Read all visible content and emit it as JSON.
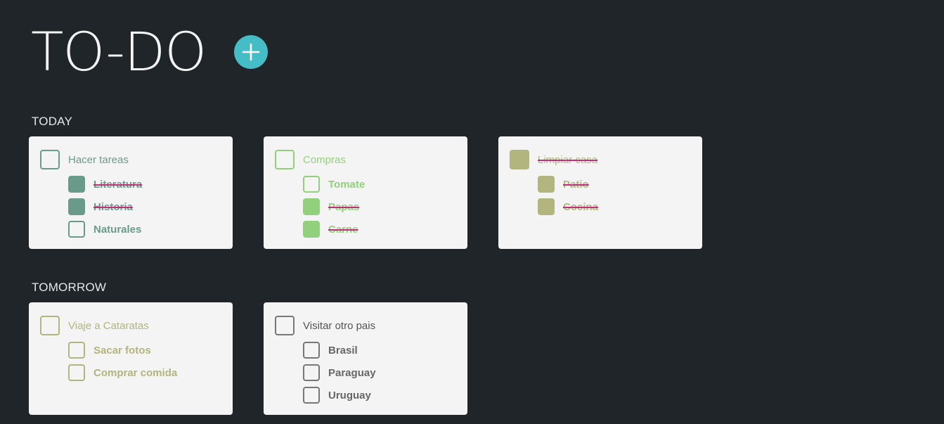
{
  "app": {
    "title": "TO-DO"
  },
  "colors": {
    "background": "#1f2529",
    "card": "#f4f4f4",
    "add_button": "#44bdc6",
    "strike": "#c2307a",
    "teal": "#6a9a8a",
    "green": "#93d07e",
    "olive": "#b2b57e",
    "gray": "#777777"
  },
  "sections": [
    {
      "label": "TODAY",
      "cards": [
        {
          "color": "#6a9a8a",
          "task": {
            "label": "Hacer tareas",
            "done": false
          },
          "subtasks": [
            {
              "label": "Literatura",
              "done": true
            },
            {
              "label": "Historia",
              "done": true
            },
            {
              "label": "Naturales",
              "done": false
            }
          ]
        },
        {
          "color": "#93d07e",
          "task": {
            "label": "Compras",
            "done": false
          },
          "subtasks": [
            {
              "label": "Tomate",
              "done": false
            },
            {
              "label": "Papas",
              "done": true
            },
            {
              "label": "Carne",
              "done": true
            }
          ]
        },
        {
          "color": "#b2b57e",
          "task": {
            "label": "Limpiar casa",
            "done": true
          },
          "subtasks": [
            {
              "label": "Patio",
              "done": true
            },
            {
              "label": "Cocina",
              "done": true
            }
          ]
        }
      ]
    },
    {
      "label": "TOMORROW",
      "cards": [
        {
          "color": "#b2b57e",
          "task": {
            "label": "Viaje a Cataratas",
            "done": false
          },
          "subtasks": [
            {
              "label": "Sacar fotos",
              "done": false
            },
            {
              "label": "Comprar comida",
              "done": false
            }
          ]
        },
        {
          "color": "#777777",
          "task": {
            "label": "Visitar otro pais",
            "done": false
          },
          "subtasks": [
            {
              "label": "Brasil",
              "done": false
            },
            {
              "label": "Paraguay",
              "done": false
            },
            {
              "label": "Uruguay",
              "done": false
            }
          ]
        }
      ]
    }
  ]
}
